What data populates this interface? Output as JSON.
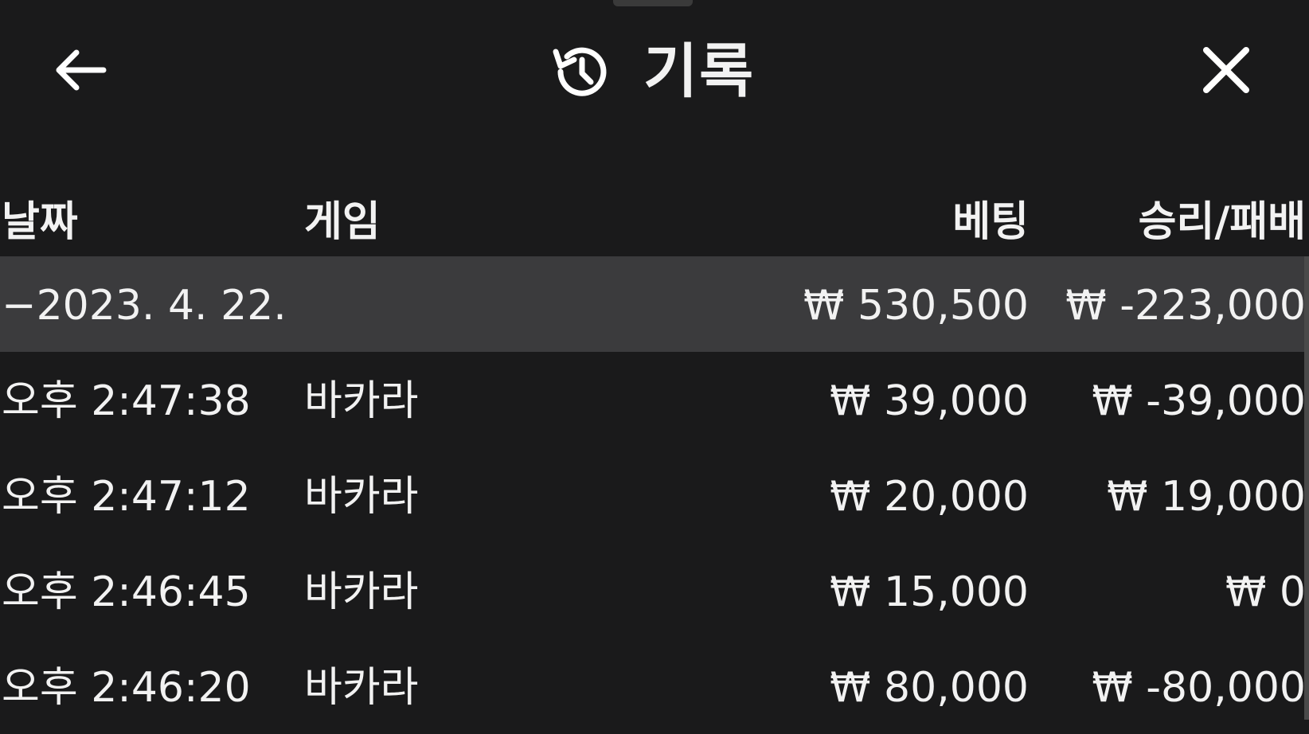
{
  "header": {
    "title": "기록",
    "back_icon": "arrow-left-icon",
    "history_icon": "history-icon",
    "close_icon": "close-icon"
  },
  "columns": {
    "date": "날짜",
    "game": "게임",
    "bet": "베팅",
    "win_loss": "승리/패배"
  },
  "summary_row": {
    "date": "−2023. 4. 22.",
    "bet": "₩ 530,500",
    "win_loss": "₩ -223,000"
  },
  "rows": [
    {
      "time": "오후 2:47:38",
      "game": "바카라",
      "bet": "₩ 39,000",
      "win_loss": "₩ -39,000"
    },
    {
      "time": "오후 2:47:12",
      "game": "바카라",
      "bet": "₩ 20,000",
      "win_loss": "₩ 19,000"
    },
    {
      "time": "오후 2:46:45",
      "game": "바카라",
      "bet": "₩ 15,000",
      "win_loss": "₩ 0"
    },
    {
      "time": "오후 2:46:20",
      "game": "바카라",
      "bet": "₩ 80,000",
      "win_loss": "₩ -80,000"
    }
  ],
  "colors": {
    "background": "#1a1a1b",
    "summary_row": "#3b3b3d",
    "text": "#f2f2f2"
  }
}
